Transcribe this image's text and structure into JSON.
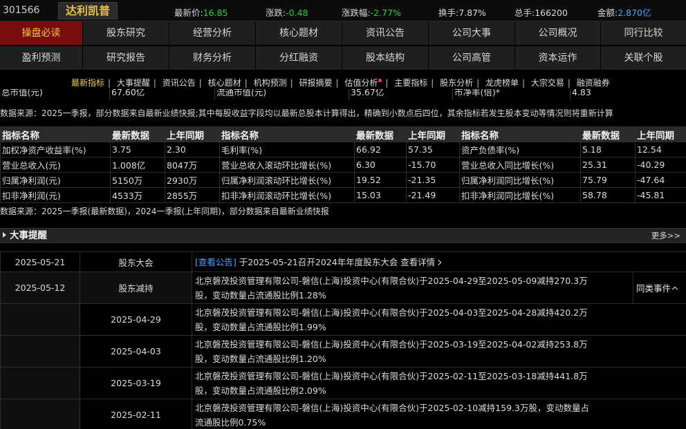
{
  "header": {
    "code": "301566",
    "name": "达利凯普",
    "quotes": [
      {
        "label": "最新价:",
        "value": "16.85",
        "color": "g"
      },
      {
        "label": "涨跌:",
        "value": "-0.48",
        "color": "g"
      },
      {
        "label": "涨跌幅:",
        "value": "-2.77%",
        "color": "g"
      },
      {
        "label": "换手:",
        "value": "7.87%",
        "color": "w"
      },
      {
        "label": "总手:",
        "value": "166200",
        "color": "w"
      },
      {
        "label": "金额:",
        "value": "2.870亿",
        "color": "b"
      }
    ]
  },
  "tabs_row1": [
    "操盘必读",
    "股东研究",
    "经营分析",
    "核心题材",
    "资讯公告",
    "公司大事",
    "公司概况",
    "同行比较"
  ],
  "tabs_row2": [
    "盈利预测",
    "研究报告",
    "财务分析",
    "分红融资",
    "股本结构",
    "公司高管",
    "资本运作",
    "关联个股"
  ],
  "subnav": [
    "最新指标",
    "大事提醒",
    "资讯公告",
    "核心题材",
    "机构预测",
    "研报摘要",
    "估值分析",
    "主要指标",
    "股东分析",
    "龙虎榜单",
    "大宗交易",
    "融资融券"
  ],
  "cutrow": {
    "c1": "总市值(元)",
    "c2": "67.60亿",
    "c3": "流通市值(元)",
    "c4": "35.67亿",
    "c5": "市净率(倍)*",
    "c6": "4.83"
  },
  "note1": "数据来源：2025一季报，部分数据来自最新业绩快报;其中每股收益字段均以最新总股本计算得出，精确到小数点后四位，其余指标若发生股本变动等情况则将重新计算",
  "metrics": {
    "headers": [
      "指标名称",
      "最新数据",
      "上年同期",
      "指标名称",
      "最新数据",
      "上年同期",
      "指标名称",
      "最新数据",
      "上年同期"
    ],
    "rows": [
      [
        "加权净资产收益率(%)",
        "3.75",
        "2.30",
        "毛利率(%)",
        "66.92",
        "57.35",
        "资产负债率(%)",
        "5.18",
        "12.54"
      ],
      [
        "营业总收入(元)",
        "1.008亿",
        "8047万",
        "营业总收入滚动环比增长(%)",
        "6.30",
        "-15.70",
        "营业总收入同比增长(%)",
        "25.31",
        "-40.29"
      ],
      [
        "归属净利润(元)",
        "5150万",
        "2930万",
        "归属净利润滚动环比增长(%)",
        "19.52",
        "-21.35",
        "归属净利润同比增长(%)",
        "75.79",
        "-47.64"
      ],
      [
        "扣非净利润(元)",
        "4533万",
        "2855万",
        "扣非净利润滚动环比增长(%)",
        "15.03",
        "-21.49",
        "扣非净利润同比增长(%)",
        "58.78",
        "-45.81"
      ]
    ]
  },
  "note2": "数据来源：2025一季报(最新数据)，2024一季报(上年同期)，部分数据来自最新业绩快报",
  "section": {
    "title": "大事提醒",
    "more": "更多>>"
  },
  "events": {
    "e1": {
      "date": "2025-05-21",
      "type": "股东大会",
      "link": "[查看公告]",
      "text": " 于2025-05-21召开2024年年度股东大会 ",
      "detail": "查看详情"
    },
    "e2": {
      "date": "2025-05-12",
      "type": "股东减持",
      "line1": "北京磐茂投资管理有限公司-磐信(上海)投资中心(有限合伙)于2025-04-29至2025-05-09减持270.3万",
      "line2": "股，变动数量占流通股比例1.28%",
      "side": "同类事件"
    },
    "subs": [
      {
        "date": "2025-04-29",
        "line1": "北京磐茂投资管理有限公司-磐信(上海)投资中心(有限合伙)于2025-04-03至2025-04-28减持420.2万",
        "line2": "股，变动数量占流通股比例1.99%"
      },
      {
        "date": "2025-04-03",
        "line1": "北京磐茂投资管理有限公司-磐信(上海)投资中心(有限合伙)于2025-03-19至2025-04-02减持253.8万",
        "line2": "股，变动数量占流通股比例1.20%"
      },
      {
        "date": "2025-03-19",
        "line1": "北京磐茂投资管理有限公司-磐信(上海)投资中心(有限合伙)于2025-02-11至2025-03-18减持441.8万",
        "line2": "股，变动数量占流通股比例2.09%"
      },
      {
        "date": "2025-02-11",
        "line1": "北京磐茂投资管理有限公司-磐信(上海)投资中心(有限合伙)于2025-02-10减持159.3万股，变动数量占",
        "line2": "流通股比例0.75%"
      }
    ]
  }
}
